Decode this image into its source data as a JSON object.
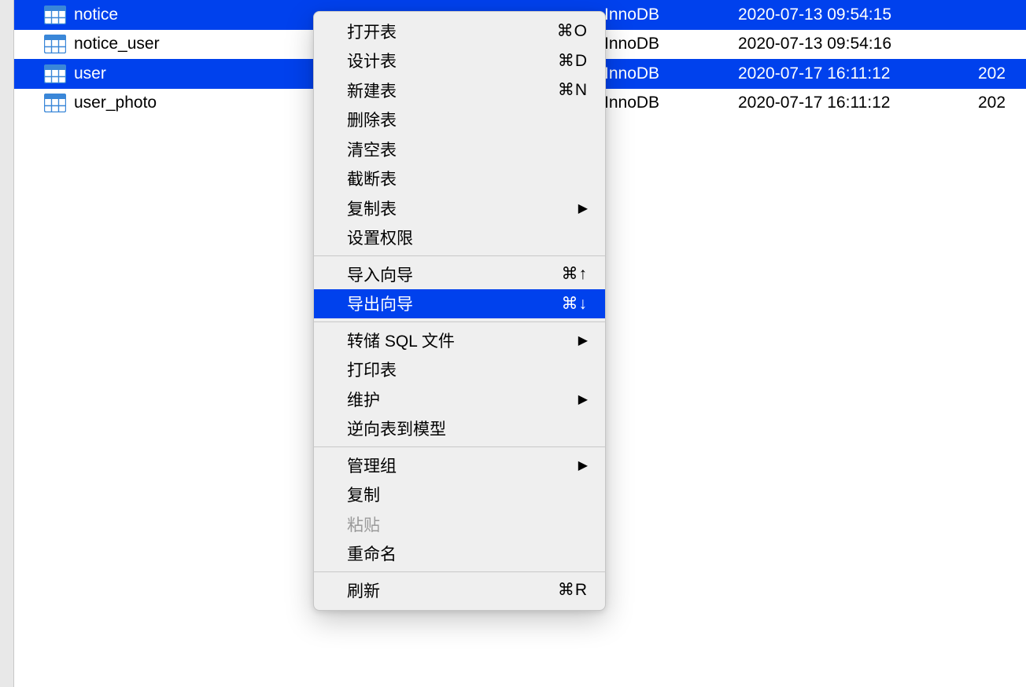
{
  "tables": [
    {
      "name": "notice",
      "engine": "InnoDB",
      "date1": "2020-07-13 09:54:15",
      "date2": "",
      "selected": true
    },
    {
      "name": "notice_user",
      "engine": "InnoDB",
      "date1": "2020-07-13 09:54:16",
      "date2": "",
      "selected": false
    },
    {
      "name": "user",
      "engine": "InnoDB",
      "date1": "2020-07-17 16:11:12",
      "date2": "202",
      "selected": true
    },
    {
      "name": "user_photo",
      "engine": "InnoDB",
      "date1": "2020-07-17 16:11:12",
      "date2": "202",
      "selected": false
    }
  ],
  "context_menu": {
    "groups": [
      [
        {
          "label": "打开表",
          "shortcut": "⌘O"
        },
        {
          "label": "设计表",
          "shortcut": "⌘D"
        },
        {
          "label": "新建表",
          "shortcut": "⌘N"
        },
        {
          "label": "删除表"
        },
        {
          "label": "清空表"
        },
        {
          "label": "截断表"
        },
        {
          "label": "复制表",
          "submenu": true
        },
        {
          "label": "设置权限"
        }
      ],
      [
        {
          "label": "导入向导",
          "shortcut": "⌘↑"
        },
        {
          "label": "导出向导",
          "shortcut": "⌘↓",
          "highlighted": true
        }
      ],
      [
        {
          "label": "转储 SQL 文件",
          "submenu": true
        },
        {
          "label": "打印表"
        },
        {
          "label": "维护",
          "submenu": true
        },
        {
          "label": "逆向表到模型"
        }
      ],
      [
        {
          "label": "管理组",
          "submenu": true
        },
        {
          "label": "复制"
        },
        {
          "label": "粘贴",
          "disabled": true
        },
        {
          "label": "重命名"
        }
      ],
      [
        {
          "label": "刷新",
          "shortcut": "⌘R"
        }
      ]
    ]
  }
}
